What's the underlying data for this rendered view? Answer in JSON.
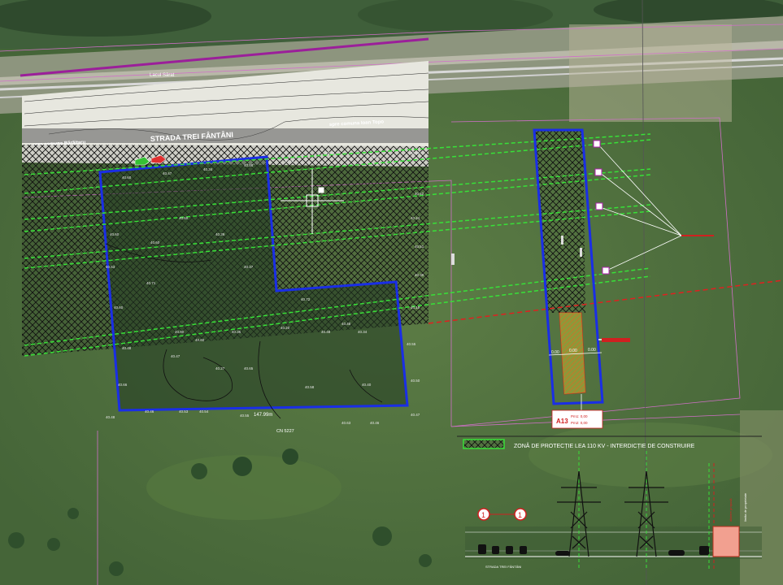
{
  "map": {
    "street_label_top": "Lacul Sărat",
    "street_main": "STRADA TREI FÂNTÂNI",
    "dir_left": "spre comuna Bărăitaru",
    "dir_right": "spre comuna Ioan Topo",
    "area_measure": "147.99m",
    "cadastral": "CN 5227",
    "lot_code": "A13",
    "lot_values": [
      "Pm1: 0,00",
      "Pm2: 0,00"
    ],
    "lot_offset_labels": [
      "0.00",
      "0.00",
      "0.00"
    ],
    "elevations": [
      "40.48",
      "40.46",
      "40.53",
      "40.54",
      "40.55",
      "40.63",
      "40.46",
      "40.47",
      "40.50",
      "40.55",
      "40.18",
      "40.30",
      "40.51",
      "40.44",
      "40.52",
      "40.56",
      "40.52",
      "40.40",
      "40.54",
      "40.58",
      "40.34",
      "40.47",
      "40.60",
      "40.66",
      "40.48",
      "40.60",
      "40.53",
      "40.60",
      "40.60",
      "40.60",
      "40.39",
      "40.37",
      "40.72",
      "40.48",
      "40.34",
      "40.48",
      "40.20",
      "40.35",
      "40.60",
      "40.47",
      "40.27",
      "40.65",
      "40.58",
      "40.40",
      "40.90",
      "40.71"
    ]
  },
  "legend": {
    "protection_zone_text": "ZONĂ DE PROTECȚIE LEA 110 KV - INTERDICȚIE DE CONSTRUIRE"
  },
  "section": {
    "street_label": "STRADA TREI FÂNTÂNI",
    "marker_number": "1",
    "right_labels": [
      "limita de proprietate",
      "aliniere propusă"
    ]
  },
  "colors": {
    "parcel_border": "#1a2ee6",
    "power_line": "#38e038",
    "hatch": "#1a1a1a",
    "road_line": "#8a1f8f",
    "red_line": "#e02020"
  }
}
